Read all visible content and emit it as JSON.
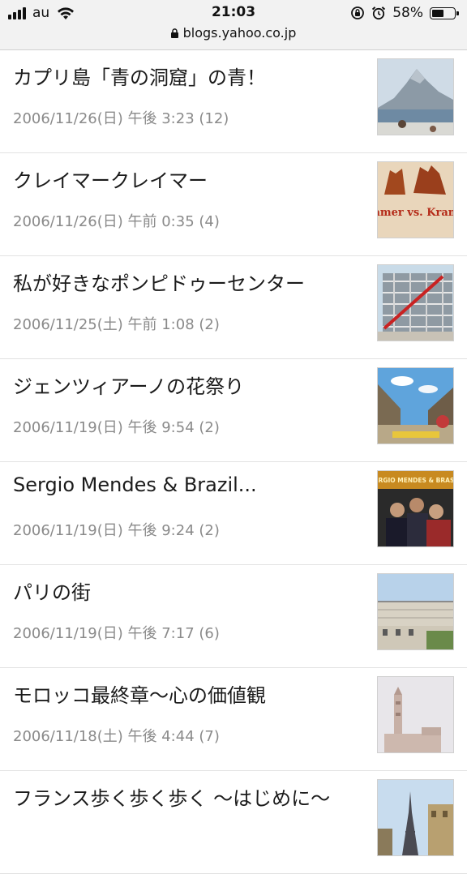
{
  "status_bar": {
    "carrier": "au",
    "time": "21:03",
    "battery_percent": "58%",
    "battery_level": 0.58,
    "url": "blogs.yahoo.co.jp"
  },
  "posts": [
    {
      "title": "カプリ島「青の洞窟」の青！",
      "meta": "2006/11/26(日) 午後 3:23 (12)",
      "thumb_icon": "coast-mountain-photo"
    },
    {
      "title": "クレイマークレイマー",
      "meta": "2006/11/26(日) 午前 0:35 (4)",
      "thumb_icon": "kramer-poster-photo",
      "thumb_text": "Kramer vs. Kramer"
    },
    {
      "title": "私が好きなポンピドゥーセンター",
      "meta": "2006/11/25(土) 午前 1:08 (2)",
      "thumb_icon": "pompidou-building-photo"
    },
    {
      "title": "ジェンツィアーノの花祭り",
      "meta": "2006/11/19(日) 午後 9:54 (2)",
      "thumb_icon": "flower-street-photo"
    },
    {
      "title": "Sergio Mendes & Brazil...",
      "meta": "2006/11/19(日) 午後 9:24 (2)",
      "thumb_icon": "album-cover-photo",
      "thumb_text": "SERGIO MENDES & BRASIL"
    },
    {
      "title": "パリの街",
      "meta": "2006/11/19(日) 午後 7:17 (6)",
      "thumb_icon": "paris-rooftops-photo"
    },
    {
      "title": "モロッコ最終章〜心の価値観",
      "meta": "2006/11/18(土) 午後 4:44 (7)",
      "thumb_icon": "mosque-minaret-photo"
    },
    {
      "title": "フランス歩く歩く歩く 〜はじめに〜",
      "meta": "",
      "thumb_icon": "eiffel-tower-photo"
    }
  ]
}
